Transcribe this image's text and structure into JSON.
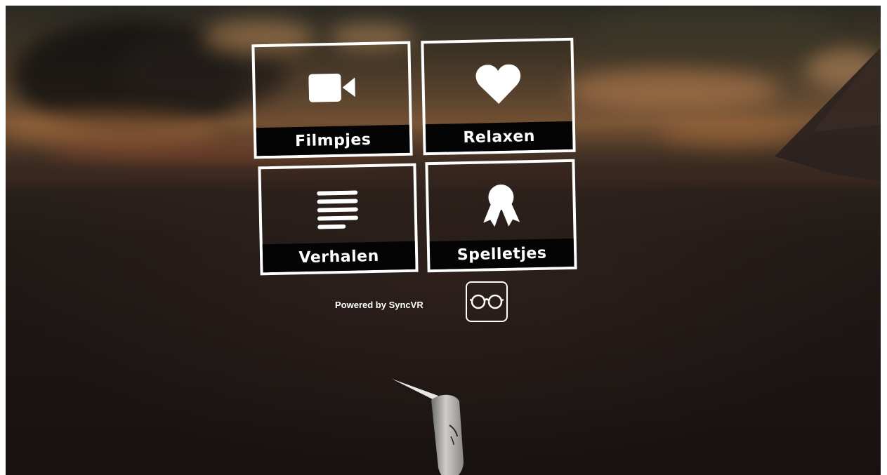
{
  "menu": {
    "tiles": [
      {
        "label": "Filmpjes",
        "icon": "video-camera-icon"
      },
      {
        "label": "Relaxen",
        "icon": "heart-icon"
      },
      {
        "label": "Verhalen",
        "icon": "text-lines-icon"
      },
      {
        "label": "Spelletjes",
        "icon": "award-ribbon-icon"
      }
    ]
  },
  "footer": {
    "powered_by": "Powered by SyncVR",
    "logo_icon": "syncvr-glasses-logo-icon"
  },
  "colors": {
    "tile_border": "#ffffff",
    "label_bar": "#050404",
    "text": "#ffffff"
  }
}
